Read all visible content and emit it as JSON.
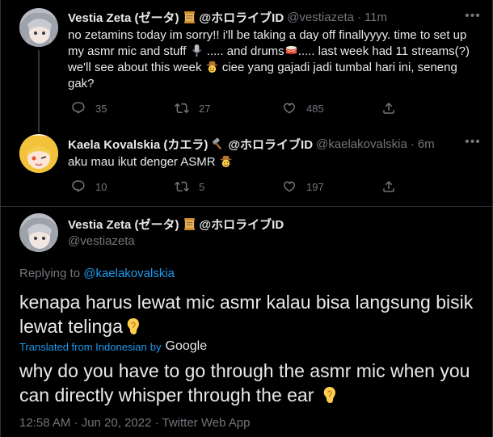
{
  "tweet1": {
    "name": "Vestia Zeta (ゼータ)",
    "org": "@ホロライブID",
    "handle": "@vestiazeta",
    "time": "11m",
    "line1": "no zetamins today im sorry!! i'll be taking a day off finallyyyy. time to set up",
    "line2a": "my asmr mic and stuff",
    "line2b": "..... and drums",
    "line2c": "..... last week had 11 streams(?)",
    "line3a": "we'll see about this week",
    "line3b": "ciee yang gajadi jadi tumbal hari ini, seneng",
    "line4": "gak?",
    "replies": "35",
    "retweets": "27",
    "likes": "485"
  },
  "tweet2": {
    "name": "Kaela Kovalskia (カエラ)",
    "org": "@ホロライブID",
    "handle": "@kaelakovalskia",
    "time": "6m",
    "text": "aku mau ikut denger ASMR",
    "replies": "10",
    "retweets": "5",
    "likes": "197"
  },
  "main": {
    "name": "Vestia Zeta (ゼータ)",
    "org": "@ホロライブID",
    "handle": "@vestiazeta",
    "replying_prefix": "Replying to",
    "replying_to": "@kaelakovalskia",
    "text_line1": "kenapa harus lewat mic asmr kalau bisa langsung bisik",
    "text_line2": "lewat telinga",
    "translated_label": "Translated from Indonesian",
    "translated_by": "by",
    "translator": "Google",
    "translation_line1": "why do you have to go through the asmr mic when you",
    "translation_line2": "can directly whisper through the ear",
    "timestamp": "12:58 AM · Jun 20, 2022 · Twitter Web App"
  },
  "icons": {
    "reply": "reply-icon",
    "retweet": "retweet-icon",
    "like": "heart-icon",
    "share": "share-icon",
    "more": "more-icon"
  },
  "colors": {
    "background": "#000000",
    "text": "#e7e9ea",
    "muted": "#71767b",
    "link": "#1d9bf0",
    "border": "#2f3336"
  }
}
